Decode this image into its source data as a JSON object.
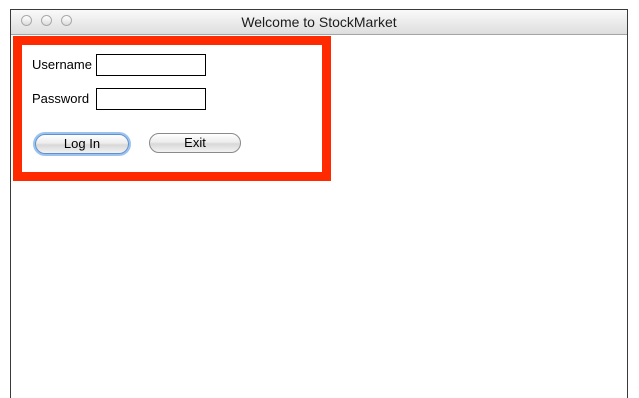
{
  "window": {
    "title": "Welcome to StockMarket"
  },
  "login": {
    "username_label": "Username",
    "username_value": "",
    "password_label": "Password",
    "password_value": "",
    "login_button": "Log In",
    "exit_button": "Exit"
  },
  "colors": {
    "panel_border": "#ff2a00",
    "focus_ring": "#9cc3f0"
  },
  "icons": {
    "window_controls": [
      "close-icon",
      "minimize-icon",
      "zoom-icon"
    ]
  }
}
